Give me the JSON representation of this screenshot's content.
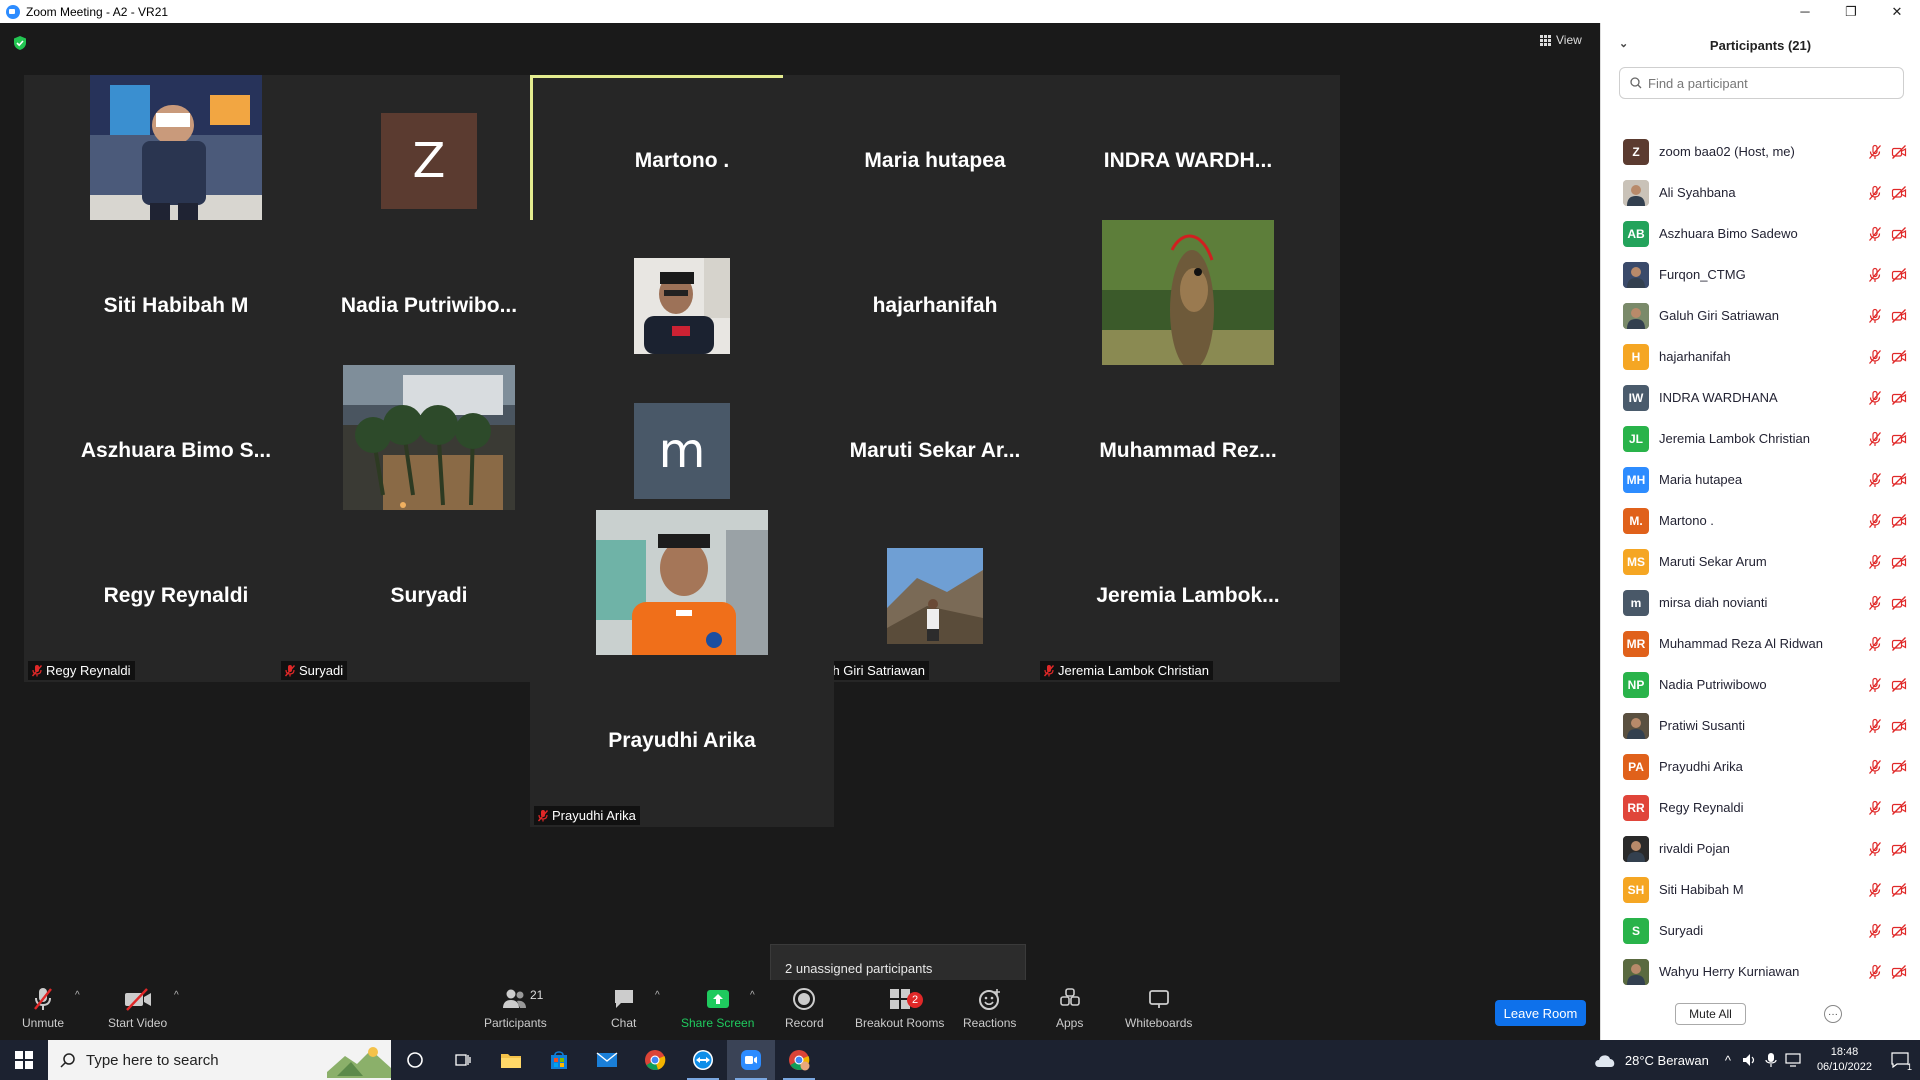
{
  "window": {
    "title": "Zoom Meeting - A2 - VR21",
    "minimize": "─",
    "maximize": "❐",
    "close": "✕"
  },
  "view_label": "View",
  "tiles": [
    {
      "display": "",
      "label": "Furqon_CTMG",
      "kind": "photo",
      "photo": "man-standing-mall"
    },
    {
      "display": "Z",
      "label": "zoom baa02",
      "kind": "letter",
      "color": "#5b3b30"
    },
    {
      "display": "Martono .",
      "label": "Martono .",
      "kind": "name",
      "active": true
    },
    {
      "display": "Maria hutapea",
      "label": "Maria hutapea",
      "kind": "name"
    },
    {
      "display": "INDRA  WARDH...",
      "label": "INDRA WARDHANA",
      "kind": "name"
    },
    {
      "display": "Siti Habibah M",
      "label": "Siti Habibah M",
      "kind": "name"
    },
    {
      "display": "Nadia  Putriwibo...",
      "label": "Nadia Putriwibowo",
      "kind": "name"
    },
    {
      "display": "",
      "label": "rivaldi Pojan",
      "kind": "photo-small",
      "photo": "man-portrait"
    },
    {
      "display": "hajarhanifah",
      "label": "hajarhanifah",
      "kind": "name"
    },
    {
      "display": "",
      "label": "Wahyu Herry Kurniawan",
      "kind": "photo",
      "photo": "fish-river"
    },
    {
      "display": "Aszhuara  Bimo  S...",
      "label": "Aszhuara Bimo Sadewo",
      "kind": "name"
    },
    {
      "display": "",
      "label": "Pratiwi Susanti",
      "kind": "photo",
      "photo": "villa-palms"
    },
    {
      "display": "m",
      "label": "mirsa diah novianti",
      "kind": "letter",
      "color": "#495868"
    },
    {
      "display": "Maruti  Sekar  Ar...",
      "label": "Maruti Sekar Arum",
      "kind": "name"
    },
    {
      "display": "Muhammad  Rez...",
      "label": "Muhammad Reza Al Ridwan",
      "kind": "name"
    },
    {
      "display": "Regy Reynaldi",
      "label": "Regy Reynaldi",
      "kind": "name"
    },
    {
      "display": "Suryadi",
      "label": "Suryadi",
      "kind": "name"
    },
    {
      "display": "",
      "label": "Ali Syahbana",
      "kind": "photo",
      "photo": "man-orange-uniform"
    },
    {
      "display": "",
      "label": "Galuh Giri Satriawan",
      "kind": "photo-small",
      "photo": "man-mountain"
    },
    {
      "display": "Jeremia  Lambok...",
      "label": "Jeremia Lambok Christian",
      "kind": "name"
    },
    {
      "display": "Prayudhi Arika",
      "label": "Prayudhi Arika",
      "kind": "name"
    }
  ],
  "tooltip": "2 unassigned participants",
  "toolbar": {
    "unmute": "Unmute",
    "start_video": "Start Video",
    "participants": "Participants",
    "participants_count": "21",
    "chat": "Chat",
    "share_screen": "Share Screen",
    "record": "Record",
    "breakout_rooms": "Breakout Rooms",
    "breakout_badge": "2",
    "reactions": "Reactions",
    "apps": "Apps",
    "whiteboards": "Whiteboards",
    "leave_room": "Leave Room"
  },
  "panel": {
    "title": "Participants (21)",
    "search_placeholder": "Find a participant",
    "mute_all": "Mute All",
    "more": "···",
    "participants": [
      {
        "name": "zoom baa02 (Host, me)",
        "initials": "Z",
        "color": "#5b3b30"
      },
      {
        "name": "Ali Syahbana",
        "initials": "",
        "color": "#c9c2b8",
        "photo": true
      },
      {
        "name": "Aszhuara Bimo Sadewo",
        "initials": "AB",
        "color": "#23a35b"
      },
      {
        "name": "Furqon_CTMG",
        "initials": "",
        "color": "#3a4a6a",
        "photo": true
      },
      {
        "name": "Galuh Giri Satriawan",
        "initials": "",
        "color": "#7a8a6a",
        "photo": true
      },
      {
        "name": "hajarhanifah",
        "initials": "H",
        "color": "#f5a623"
      },
      {
        "name": "INDRA WARDHANA",
        "initials": "IW",
        "color": "#4a5b6c"
      },
      {
        "name": "Jeremia Lambok Christian",
        "initials": "JL",
        "color": "#29b34a"
      },
      {
        "name": "Maria hutapea",
        "initials": "MH",
        "color": "#2d8cff"
      },
      {
        "name": "Martono .",
        "initials": "M.",
        "color": "#e0611b"
      },
      {
        "name": "Maruti Sekar Arum",
        "initials": "MS",
        "color": "#f5a623"
      },
      {
        "name": "mirsa diah novianti",
        "initials": "m",
        "color": "#495868"
      },
      {
        "name": "Muhammad Reza Al Ridwan",
        "initials": "MR",
        "color": "#e0611b"
      },
      {
        "name": "Nadia Putriwibowo",
        "initials": "NP",
        "color": "#29b34a"
      },
      {
        "name": "Pratiwi Susanti",
        "initials": "",
        "color": "#5a5040",
        "photo": true
      },
      {
        "name": "Prayudhi Arika",
        "initials": "PA",
        "color": "#e0611b"
      },
      {
        "name": "Regy Reynaldi",
        "initials": "RR",
        "color": "#e0453a"
      },
      {
        "name": "rivaldi Pojan",
        "initials": "",
        "color": "#2a2a2a",
        "photo": true
      },
      {
        "name": "Siti Habibah M",
        "initials": "SH",
        "color": "#f5a623"
      },
      {
        "name": "Suryadi",
        "initials": "S",
        "color": "#29b34a"
      },
      {
        "name": "Wahyu Herry Kurniawan",
        "initials": "",
        "color": "#5a6a40",
        "photo": true
      }
    ]
  },
  "taskbar": {
    "search_placeholder": "Type here to search",
    "weather": "28°C  Berawan",
    "time": "18:48",
    "date": "06/10/2022",
    "notification_count": "1"
  },
  "colors": {
    "accent_blue": "#0e71eb",
    "muted_red": "#e02828",
    "active_border": "#e4ec8f",
    "share_green": "#1fca5e"
  }
}
